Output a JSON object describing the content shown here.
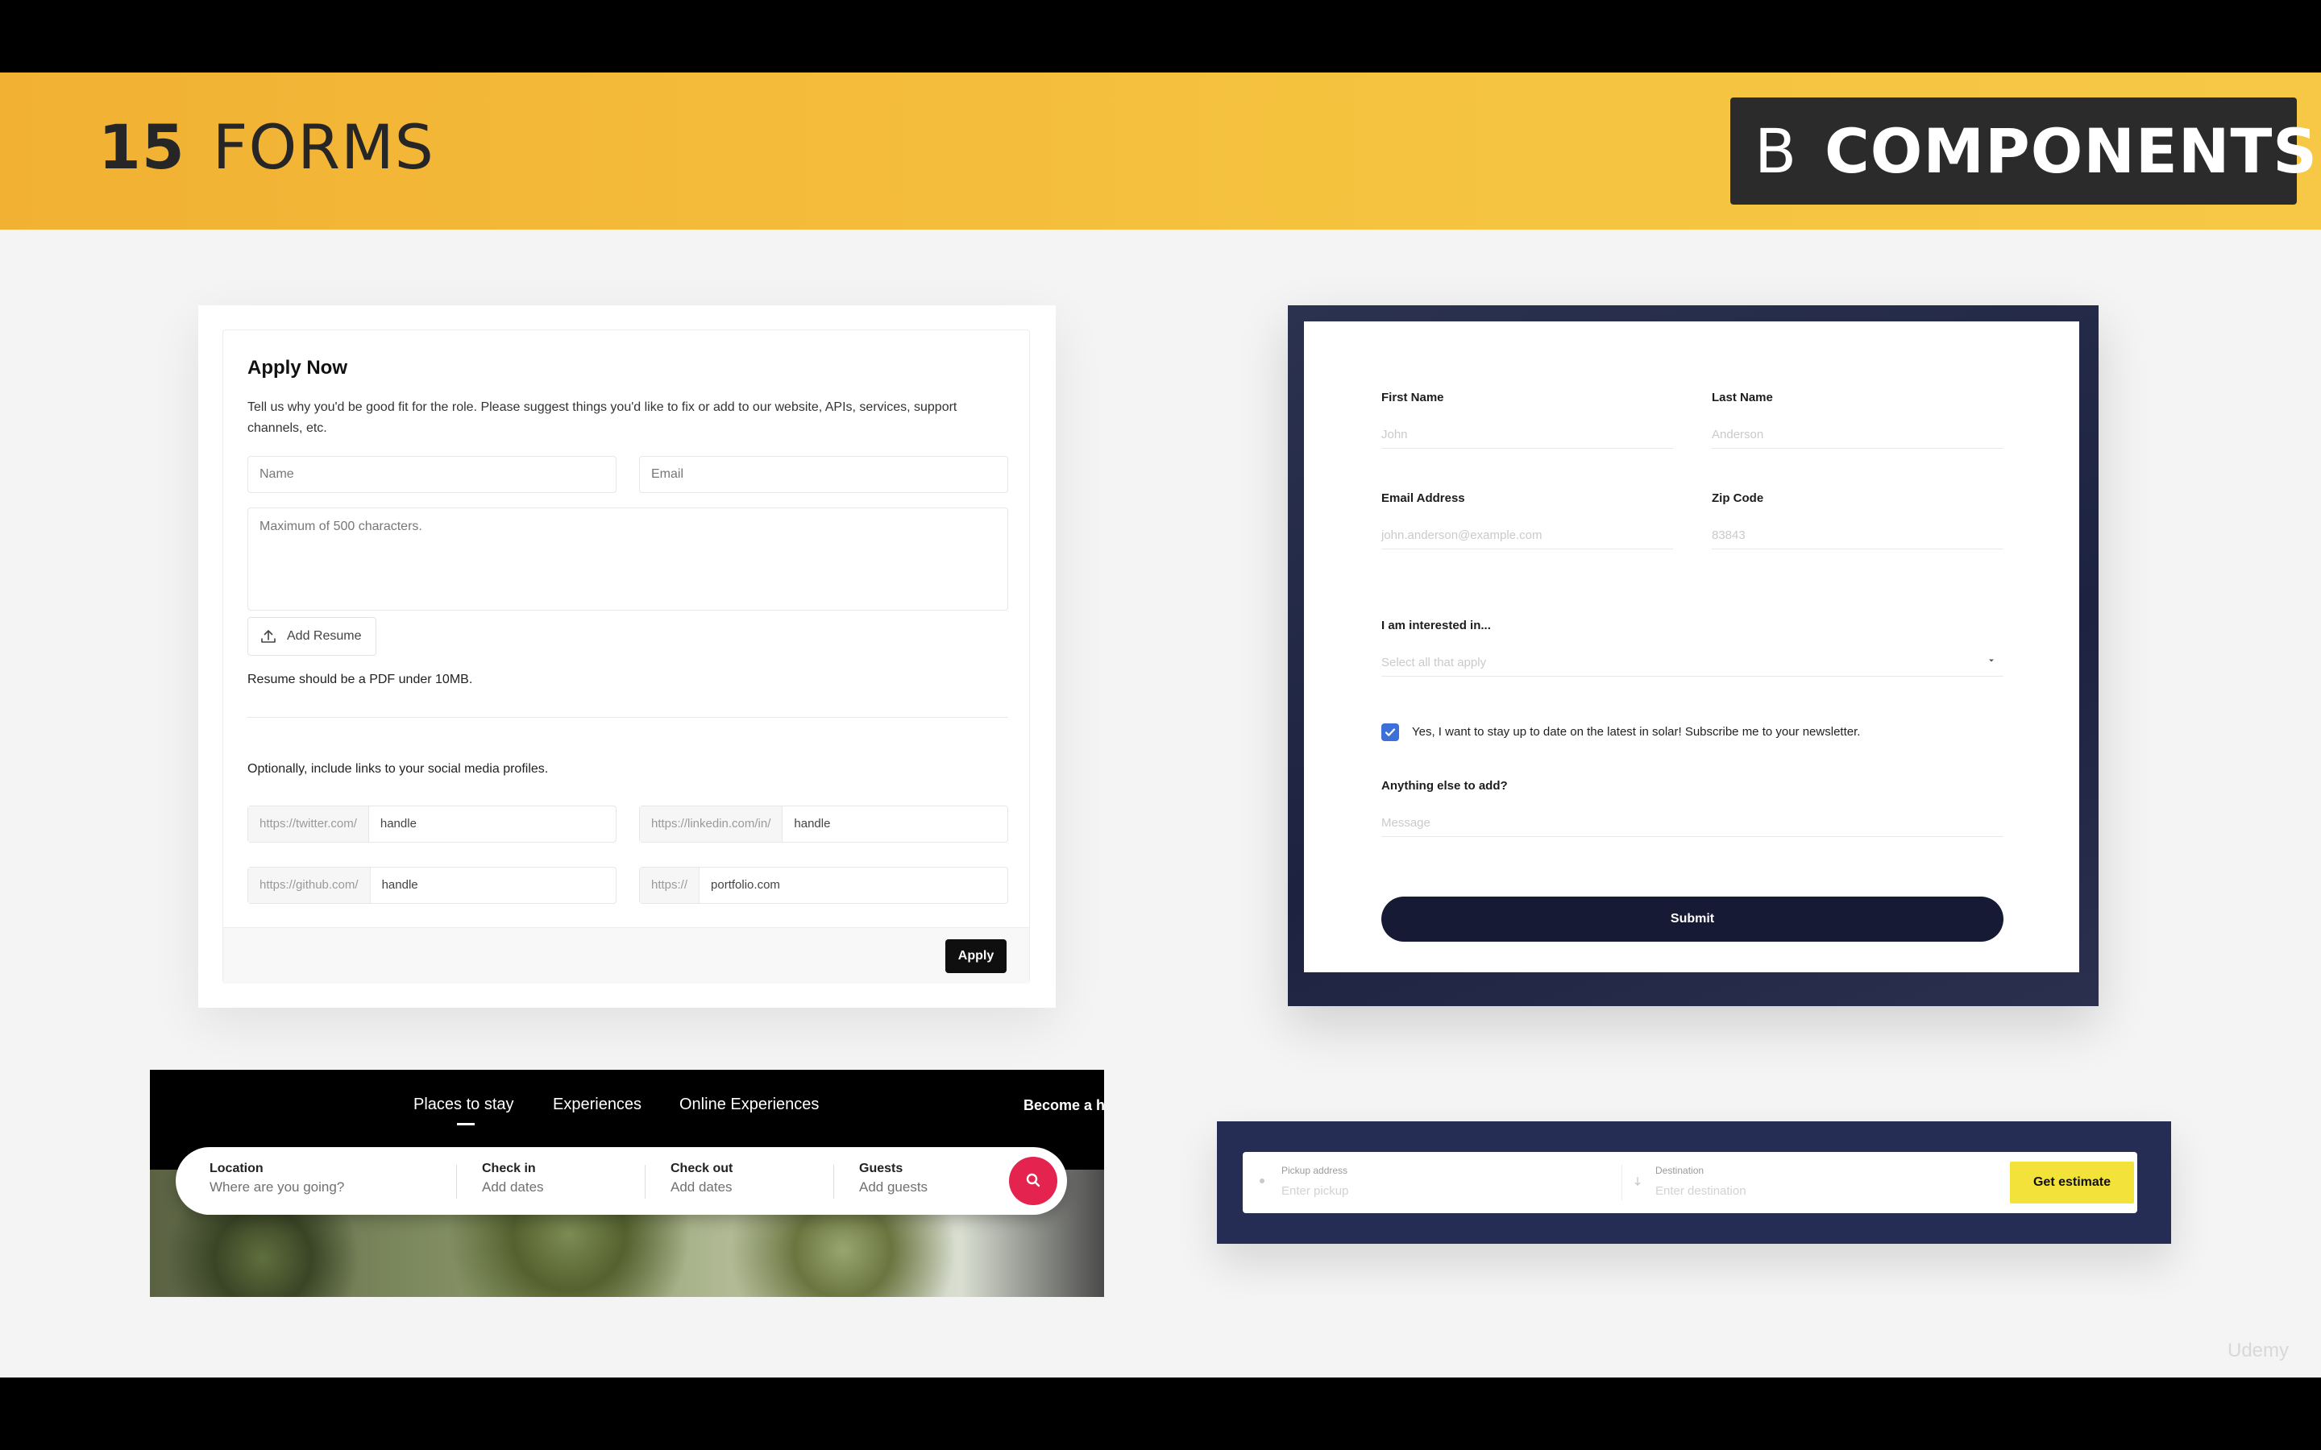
{
  "banner": {
    "number": "15",
    "title": "FORMS",
    "badge_letter": "B",
    "badge_word": "COMPONENTS"
  },
  "apply_form": {
    "title": "Apply Now",
    "description": "Tell us why you'd be good fit for the role. Please suggest things you'd like to fix or add to our website, APIs, services, support channels, etc.",
    "name_placeholder": "Name",
    "email_placeholder": "Email",
    "message_placeholder": "Maximum of 500 characters.",
    "add_resume_label": "Add Resume",
    "resume_note": "Resume should be a PDF under 10MB.",
    "social_note": "Optionally, include links to your social media profiles.",
    "links": [
      {
        "prefix": "https://twitter.com/",
        "value": "handle"
      },
      {
        "prefix": "https://linkedin.com/in/",
        "value": "handle"
      },
      {
        "prefix": "https://github.com/",
        "value": "handle"
      },
      {
        "prefix": "https://",
        "value": "portfolio.com"
      }
    ],
    "apply_label": "Apply"
  },
  "contact_form": {
    "first_name_label": "First Name",
    "first_name_placeholder": "John",
    "last_name_label": "Last Name",
    "last_name_placeholder": "Anderson",
    "email_label": "Email Address",
    "email_placeholder": "john.anderson@example.com",
    "zip_label": "Zip Code",
    "zip_placeholder": "83843",
    "interest_label": "I am interested in...",
    "interest_placeholder": "Select all that apply",
    "newsletter_text": "Yes, I want to stay up to date on the latest in solar! Subscribe me to your newsletter.",
    "newsletter_checked": true,
    "anything_label": "Anything else to add?",
    "message_placeholder": "Message",
    "submit_label": "Submit",
    "accent_color": "#3d6fd8",
    "button_color": "#161a35"
  },
  "airbnb_search": {
    "nav": [
      "Places to stay",
      "Experiences",
      "Online Experiences"
    ],
    "nav_right": "Become a h",
    "location_label": "Location",
    "location_placeholder": "Where are you going?",
    "checkin_label": "Check in",
    "checkin_placeholder": "Add dates",
    "checkout_label": "Check out",
    "checkout_placeholder": "Add dates",
    "guests_label": "Guests",
    "guests_placeholder": "Add guests",
    "search_icon": "search-icon",
    "accent_color": "#e4234f"
  },
  "ride_estimate": {
    "pickup_label": "Pickup address",
    "pickup_placeholder": "Enter pickup",
    "destination_label": "Destination",
    "destination_placeholder": "Enter destination",
    "button_label": "Get estimate",
    "button_color": "#f2e23a"
  },
  "watermark": "Udemy"
}
